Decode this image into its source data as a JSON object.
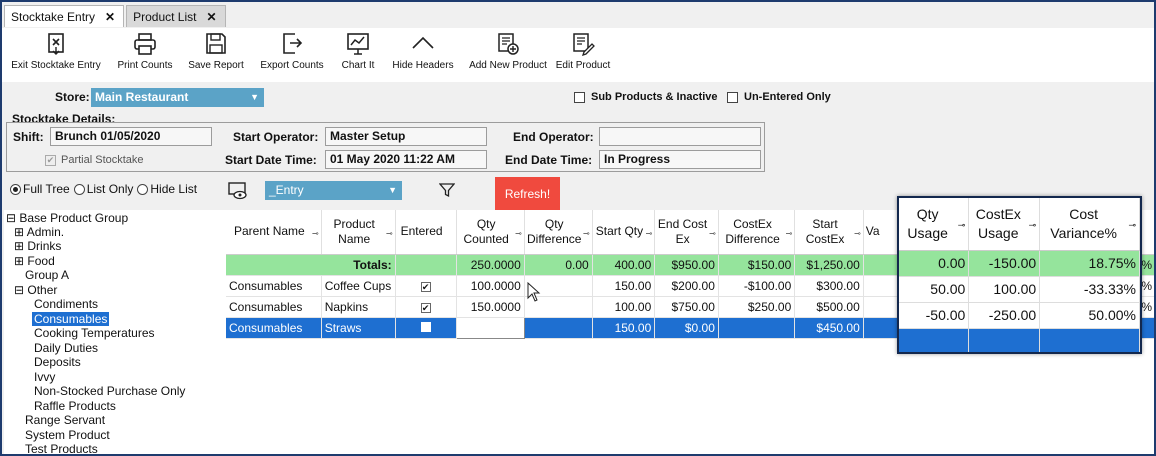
{
  "tabs": [
    {
      "label": "Stocktake Entry",
      "close": "✕"
    },
    {
      "label": "Product List",
      "close": "✕"
    }
  ],
  "toolbar": {
    "exit": "Exit Stocktake Entry",
    "print": "Print Counts",
    "save": "Save Report",
    "export": "Export Counts",
    "chart": "Chart It",
    "hide": "Hide Headers",
    "add": "Add New Product",
    "edit": "Edit Product"
  },
  "store": {
    "label": "Store:",
    "value": "Main Restaurant"
  },
  "filters": {
    "sub_products": "Sub Products & Inactive",
    "unentered": "Un-Entered Only"
  },
  "details": {
    "title": "Stocktake Details:",
    "shift_label": "Shift:",
    "shift_value": "Brunch 01/05/2020",
    "partial": "Partial Stocktake",
    "start_op_label": "Start Operator:",
    "start_op_value": "Master Setup",
    "start_dt_label": "Start Date Time:",
    "start_dt_value": "01 May 2020 11:22 AM",
    "end_op_label": "End Operator:",
    "end_op_value": "",
    "end_dt_label": "End Date Time:",
    "end_dt_value": "In Progress"
  },
  "view": {
    "full_tree": "Full Tree",
    "list_only": "List Only",
    "hide_list": "Hide List",
    "layout_value": "_Entry",
    "refresh": "Refresh!"
  },
  "tree": {
    "root": "Base Product Group",
    "admin": "Admin.",
    "drinks": "Drinks",
    "food": "Food",
    "group_a": "Group A",
    "other": "Other",
    "children": [
      "Condiments",
      "Consumables",
      "Cooking Temperatures",
      "Daily Duties",
      "Deposits",
      "Ivvy",
      "Non-Stocked Purchase Only",
      "Raffle Products"
    ],
    "range": "Range Servant",
    "system": "System Product",
    "test": "Test Products"
  },
  "grid": {
    "headers": {
      "parent": "Parent Name",
      "product": "Product Name",
      "entered": "Entered",
      "qty_counted": "Qty Counted",
      "qty_diff": "Qty Difference",
      "start_qty": "Start Qty",
      "end_cost": "End Cost Ex",
      "costex_diff": "CostEx Difference",
      "start_costex": "Start CostEx",
      "va": "Va"
    },
    "totals": {
      "label": "Totals:",
      "qty_counted": "250.0000",
      "qty_diff": "0.00",
      "start_qty": "400.00",
      "end_cost": "$950.00",
      "costex_diff": "$150.00",
      "start_costex": "$1,250.00",
      "cut": "%"
    },
    "rows": [
      {
        "parent": "Consumables",
        "product": "Coffee Cups",
        "checked": "✔",
        "qty_counted": "100.0000",
        "start_qty": "150.00",
        "end_cost": "$200.00",
        "costex_diff": "-$100.00",
        "start_costex": "$300.00",
        "cut": "%"
      },
      {
        "parent": "Consumables",
        "product": "Napkins",
        "checked": "✔",
        "qty_counted": "150.0000",
        "start_qty": "100.00",
        "end_cost": "$750.00",
        "costex_diff": "$250.00",
        "start_costex": "$500.00",
        "cut": "%"
      },
      {
        "parent": "Consumables",
        "product": "Straws",
        "checked": "",
        "qty_counted": "",
        "start_qty": "150.00",
        "end_cost": "$0.00",
        "costex_diff": "",
        "start_costex": "$450.00",
        "cut": ""
      }
    ]
  },
  "zoom": {
    "headers": {
      "qty_usage": "Qty Usage",
      "costex_usage": "CostEx Usage",
      "cost_variance": "Cost Variance%"
    },
    "totals": {
      "qty_usage": "0.00",
      "costex_usage": "-150.00",
      "cost_variance": "18.75%"
    },
    "rows": [
      {
        "qty_usage": "50.00",
        "costex_usage": "100.00",
        "cost_variance": "-33.33%"
      },
      {
        "qty_usage": "-50.00",
        "costex_usage": "-250.00",
        "cost_variance": "50.00%"
      }
    ]
  },
  "pin_glyph": "⊸",
  "colors": {
    "accent": "#1e6fd1",
    "totals": "#95e49c",
    "refresh": "#f04a3e",
    "store_dropdown": "#5ba3c7"
  }
}
